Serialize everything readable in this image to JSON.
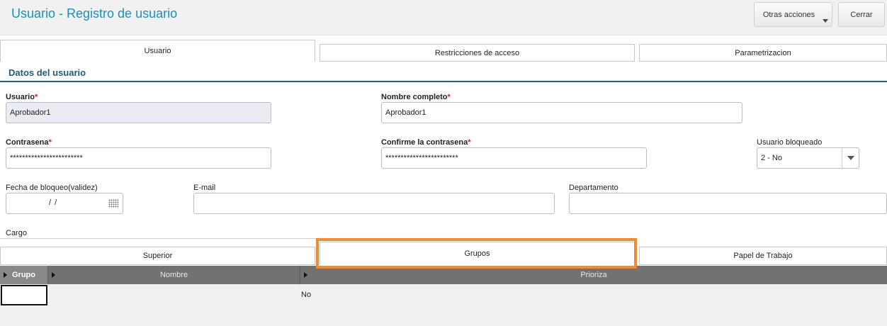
{
  "header": {
    "title": "Usuario - Registro de usuario",
    "otras_label": "Otras acciones",
    "cerrar_label": "Cerrar"
  },
  "tabs_top": [
    "Usuario",
    "Restricciones de acceso",
    "Parametrizacion"
  ],
  "section_title": "Datos del usuario",
  "form": {
    "usuario": {
      "label": "Usuario",
      "value": "Aprobador1"
    },
    "nombre": {
      "label": "Nombre completo",
      "value": "Aprobador1"
    },
    "contrasena": {
      "label": "Contrasena",
      "value": "************************"
    },
    "confirme": {
      "label": "Confirme la contrasena",
      "value": "************************"
    },
    "bloqueado": {
      "label": "Usuario bloqueado",
      "value": "2 - No"
    },
    "fecha": {
      "label": "Fecha de bloqueo(validez)",
      "value": "/ /"
    },
    "email": {
      "label": "E-mail",
      "value": ""
    },
    "departamento": {
      "label": "Departamento",
      "value": ""
    },
    "cargo": {
      "label": "Cargo"
    },
    "required_mark": "*"
  },
  "tabs_bottom": [
    "Superior",
    "Grupos",
    "Papel de Trabajo"
  ],
  "grid": {
    "columns": [
      "Grupo",
      "Nombre",
      "Prioriza"
    ],
    "rows": [
      {
        "grupo": "",
        "nombre": "",
        "prioriza": "No"
      }
    ]
  },
  "colors": {
    "title": "#1f8fb4",
    "section": "#235a7a",
    "required": "#d02020",
    "highlight": "#ef8a35"
  }
}
